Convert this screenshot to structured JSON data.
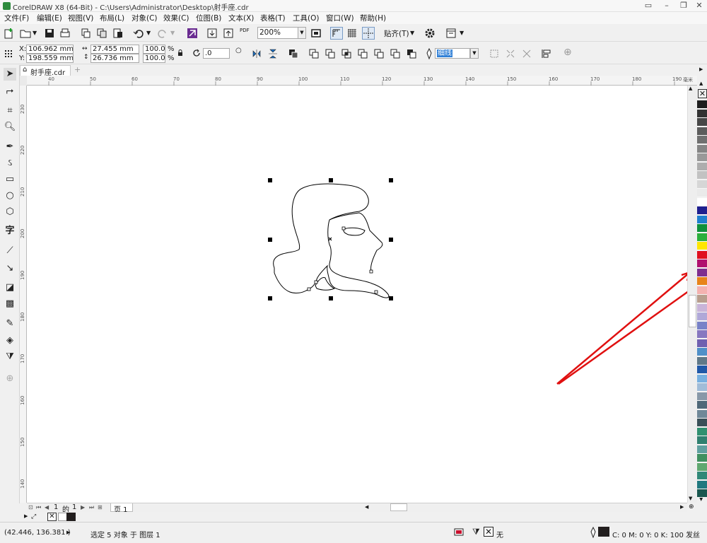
{
  "titlebar": {
    "title": "CorelDRAW X8 (64-Bit) - C:\\Users\\Administrator\\Desktop\\射手座.cdr"
  },
  "menu": [
    {
      "label": "文件(F)"
    },
    {
      "label": "编辑(E)"
    },
    {
      "label": "视图(V)"
    },
    {
      "label": "布局(L)"
    },
    {
      "label": "对象(C)"
    },
    {
      "label": "效果(C)"
    },
    {
      "label": "位图(B)"
    },
    {
      "label": "文本(X)"
    },
    {
      "label": "表格(T)"
    },
    {
      "label": "工具(O)"
    },
    {
      "label": "窗口(W)"
    },
    {
      "label": "帮助(H)"
    }
  ],
  "stdbar": {
    "pdf_label": "PDF",
    "zoom": "200%",
    "snap_label": "贴齐(T)"
  },
  "propbar": {
    "x_label": "X:",
    "x_value": "106.962 mm",
    "y_label": "Y:",
    "y_value": "198.559 mm",
    "w_value": "27.455 mm",
    "h_value": "26.736 mm",
    "scale_x": "100.0",
    "scale_y": "100.0",
    "percent": "%",
    "rotation": ".0",
    "outline": "细线"
  },
  "doc": {
    "tab": "射手座.cdr"
  },
  "hruler": {
    "ticks": [
      "40",
      "50",
      "60",
      "70",
      "80",
      "90",
      "100",
      "110",
      "120",
      "130",
      "140",
      "150",
      "160",
      "170",
      "180",
      "190"
    ],
    "unit": "毫米"
  },
  "vruler": {
    "ticks": [
      "230",
      "220",
      "210",
      "200",
      "190",
      "180",
      "170",
      "160",
      "150",
      "140"
    ]
  },
  "pagebar": {
    "current": "1",
    "of": "的",
    "total": "1",
    "page_tab": "页 1"
  },
  "status": {
    "coords": "(42.446, 136.381 )",
    "selection": "选定 5 对象 于 图层 1",
    "fill": "无",
    "outline_color": "C: 0 M: 0 Y: 0 K: 100 发丝"
  },
  "palette": [
    "#1e1e1e",
    "#333333",
    "#474747",
    "#5c5c5c",
    "#707070",
    "#858585",
    "#999999",
    "#adadad",
    "#c2c2c2",
    "#d6d6d6",
    "#eaeaea",
    "#ffffff",
    "#1f1f8f",
    "#1f7fcf",
    "#10903c",
    "#2caf3c",
    "#ffe600",
    "#e01020",
    "#b0106f",
    "#7f2f8f",
    "#e8841a",
    "#f4b2b0",
    "#b89e8e",
    "#c8b4d8",
    "#b0a8d8",
    "#7882c8",
    "#8878c0",
    "#7060b0",
    "#5090c8",
    "#607888",
    "#2058a8",
    "#78b0e0",
    "#a0bcd8",
    "#8898a8",
    "#506878",
    "#708898",
    "#3a5058",
    "#309070",
    "#308070",
    "#60a0a0",
    "#409060",
    "#60a870",
    "#308878",
    "#20787f",
    "#1a5850"
  ],
  "accent": "#e01010"
}
